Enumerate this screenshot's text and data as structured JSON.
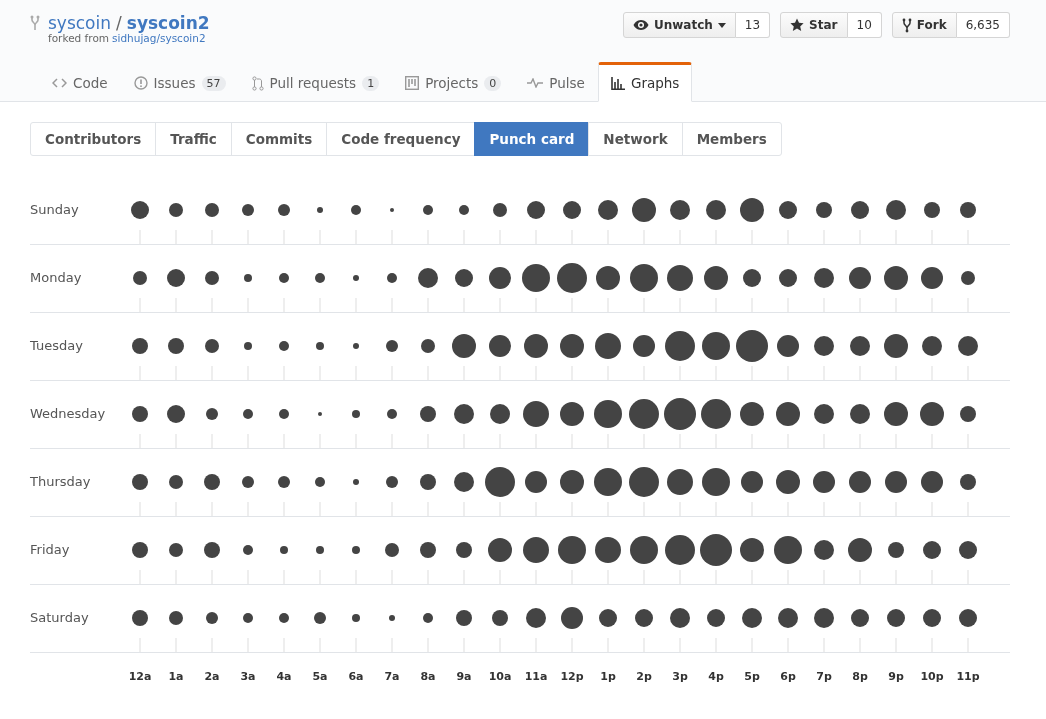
{
  "repo": {
    "owner": "syscoin",
    "separator": "/",
    "name": "syscoin2",
    "forked_from_label": "forked from",
    "forked_from": "sidhujag/syscoin2"
  },
  "actions": [
    {
      "kind": "watch",
      "label": "Unwatch",
      "count": "13"
    },
    {
      "kind": "star",
      "label": "Star",
      "count": "10"
    },
    {
      "kind": "fork",
      "label": "Fork",
      "count": "6,635"
    }
  ],
  "tabs": [
    {
      "kind": "code",
      "label": "Code",
      "selected": false
    },
    {
      "kind": "issues",
      "label": "Issues",
      "counter": "57",
      "selected": false
    },
    {
      "kind": "pulls",
      "label": "Pull requests",
      "counter": "1",
      "selected": false
    },
    {
      "kind": "projects",
      "label": "Projects",
      "counter": "0",
      "selected": false
    },
    {
      "kind": "pulse",
      "label": "Pulse",
      "selected": false
    },
    {
      "kind": "graphs",
      "label": "Graphs",
      "selected": true
    }
  ],
  "subnav": [
    {
      "label": "Contributors",
      "selected": false
    },
    {
      "label": "Traffic",
      "selected": false
    },
    {
      "label": "Commits",
      "selected": false
    },
    {
      "label": "Code frequency",
      "selected": false
    },
    {
      "label": "Punch card",
      "selected": true
    },
    {
      "label": "Network",
      "selected": false
    },
    {
      "label": "Members",
      "selected": false
    }
  ],
  "punch_card": {
    "days": [
      "Sunday",
      "Monday",
      "Tuesday",
      "Wednesday",
      "Thursday",
      "Friday",
      "Saturday"
    ],
    "hours": [
      "12a",
      "1a",
      "2a",
      "3a",
      "4a",
      "5a",
      "6a",
      "7a",
      "8a",
      "9a",
      "10a",
      "11a",
      "12p",
      "1p",
      "2p",
      "3p",
      "4p",
      "5p",
      "6p",
      "7p",
      "8p",
      "9p",
      "10p",
      "11p"
    ]
  }
}
